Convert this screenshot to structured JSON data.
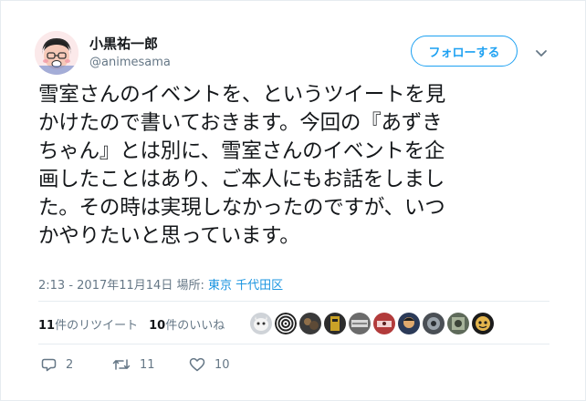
{
  "user": {
    "display_name": "小黒祐一郎",
    "handle": "@animesama",
    "avatar_icon": "user-avatar-icon"
  },
  "follow_button": {
    "label": "フォローする"
  },
  "tweet": {
    "text": "雪室さんのイベントを、というツイートを見\nかけたので書いておきます。今回の『あずき\nちゃん』とは別に、雪室さんのイベントを企\n画したことはあり、ご本人にもお話をしまし\nた。その時は実現しなかったのですが、いつ\nかやりたいと思っています。",
    "timestamp": "2:13 - 2017年11月14日",
    "location_prefix": "場所:",
    "location": "東京 千代田区"
  },
  "stats": {
    "retweets_count": "11",
    "retweets_label": "件のリツイート",
    "likes_count": "10",
    "likes_label": "件のいいね"
  },
  "actions": {
    "reply_count": "2",
    "retweet_count": "11",
    "like_count": "10"
  },
  "colors": {
    "accent": "#1da1f2",
    "link": "#1b95e0",
    "muted": "#657786",
    "text": "#14171a",
    "border": "#e6ecf0"
  }
}
